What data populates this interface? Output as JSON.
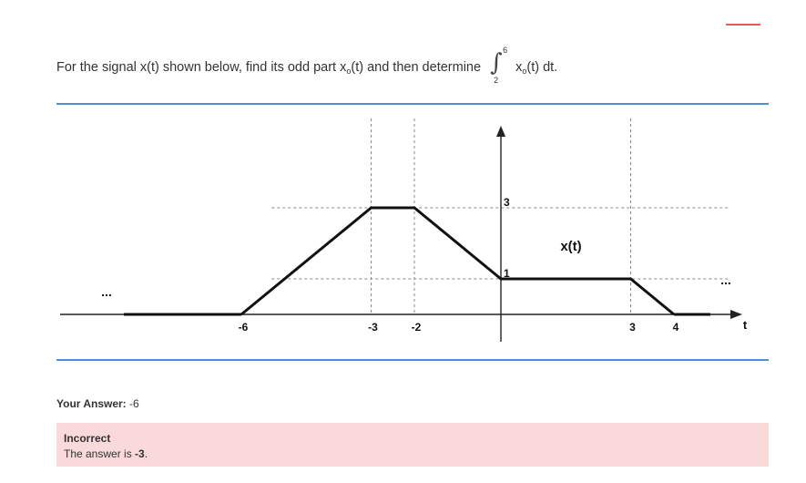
{
  "question": {
    "text_before": "For the signal x(t) shown below, find its odd part x",
    "sub_o": "o",
    "text_mid": "(t) and then determine",
    "integral_upper": "6",
    "integral_lower": "2",
    "integrand_x": "x",
    "integrand_sub": "o",
    "integrand_rest": "(t) dt."
  },
  "chart_data": {
    "type": "line",
    "title": "",
    "series": [
      {
        "name": "x(t)",
        "x": [
          -6,
          -3,
          -2,
          0,
          0,
          3,
          4
        ],
        "y": [
          0,
          3,
          3,
          1,
          1,
          1,
          0
        ]
      }
    ],
    "xlabel": "t",
    "x_ticks": [
      "-6",
      "-3",
      "-2",
      "3",
      "4"
    ],
    "y_ticks": [
      "3",
      "1"
    ],
    "curve_label": "x(t)",
    "ellipsis_left": "...",
    "ellipsis_right": "...",
    "grid": "dashed guide lines at y=1, y=3 and x=-3, -2, 3"
  },
  "answer": {
    "label": "Your Answer:",
    "value": "-6"
  },
  "feedback": {
    "title": "Incorrect",
    "text": "The answer is",
    "value": "-3",
    "period": "."
  },
  "colors": {
    "rule": "#4a90d9",
    "feedback_bg": "#f9d9d9",
    "accent": "#e35d5d"
  }
}
